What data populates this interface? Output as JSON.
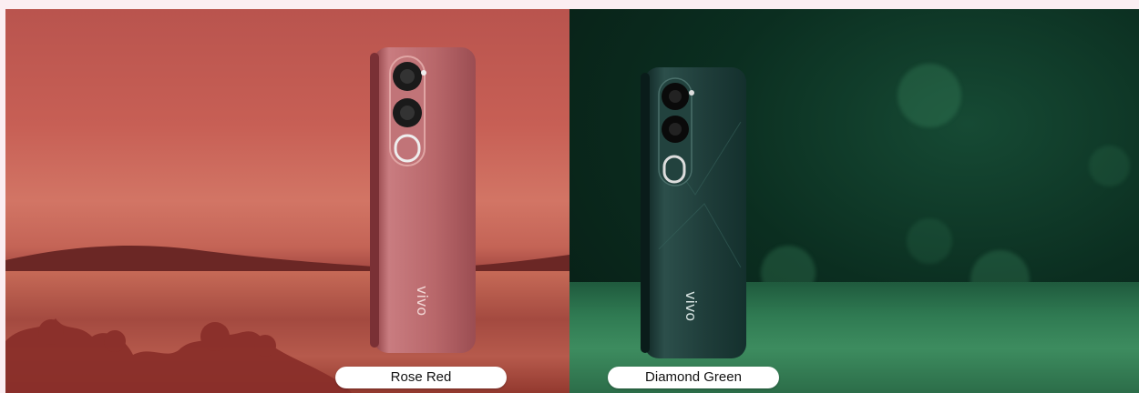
{
  "variants": [
    {
      "label": "Rose Red",
      "brand": "vivo",
      "accent": "#b6615f"
    },
    {
      "label": "Diamond Green",
      "brand": "vivo",
      "accent": "#1d3a37"
    }
  ],
  "colors": {
    "rose_bg": "#c75f55",
    "green_bg": "#0b2e20",
    "page_bg": "#fbeef2"
  },
  "icons": [
    "phone-camera-module-icon"
  ]
}
